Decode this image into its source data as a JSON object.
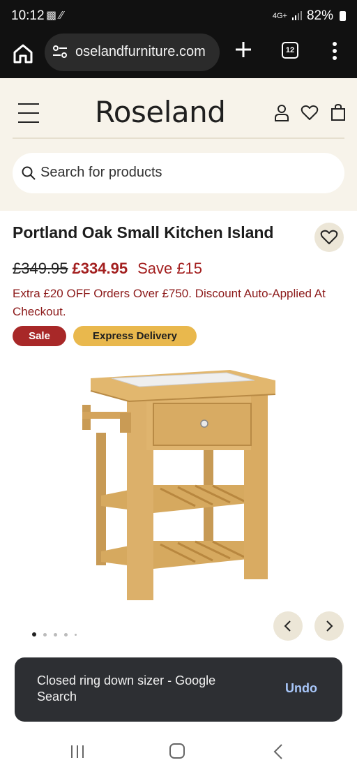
{
  "status_bar": {
    "time": "10:12",
    "network": "4G+",
    "battery": "82%"
  },
  "browser": {
    "url": "oselandfurniture.com",
    "tab_count": "12"
  },
  "site": {
    "logo": "Roseland",
    "search_placeholder": "Search for products"
  },
  "product": {
    "title": "Portland Oak Small Kitchen Island",
    "old_price": "£349.95",
    "new_price": "£334.95",
    "save": "Save £15",
    "promo": "Extra £20 OFF Orders Over £750. Discount Auto-Applied At Checkout.",
    "badges": [
      "Sale",
      "Express Delivery"
    ],
    "image_count": 5,
    "active_image": 1
  },
  "snackbar": {
    "message": "Closed ring down sizer - Google Search",
    "action": "Undo"
  },
  "colors": {
    "header_bg": "#f7f3ea",
    "sale_red": "#a82828",
    "express_gold": "#e9b84d",
    "price_red": "#a31f1f"
  }
}
